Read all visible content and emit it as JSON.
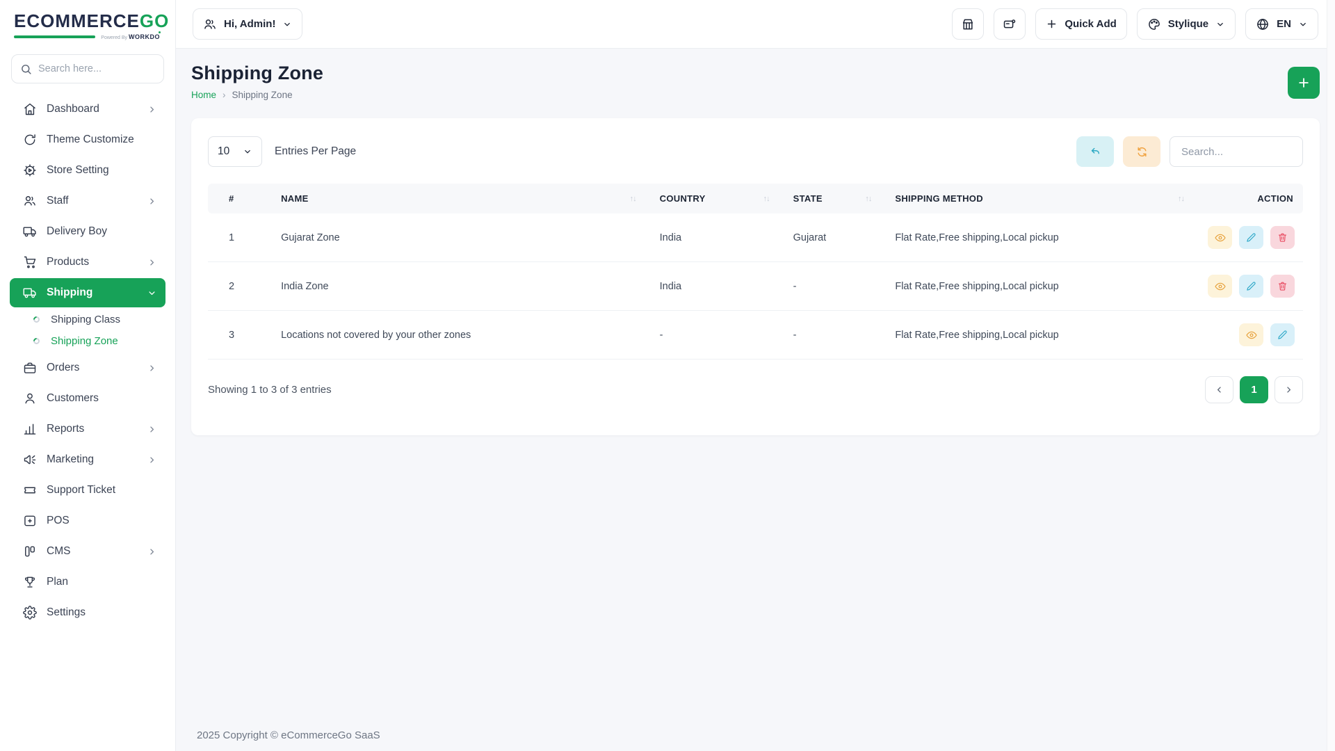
{
  "brand": {
    "name": "ECOMMERCE",
    "accent": "GO",
    "powered_by": "Powered By",
    "powered_brand": "WORKDO"
  },
  "colors": {
    "accent_green": "#17a258",
    "view_orange": "#e7a13b",
    "edit_teal": "#2aa7c7",
    "delete_red": "#e8495f",
    "cyan_chip": "#d8f1f5",
    "orange_chip": "#fcebd4"
  },
  "topbar": {
    "user_button": "Hi, Admin!",
    "quick_add_label": "Quick Add",
    "style_label": "Stylique",
    "language_label": "EN"
  },
  "sidebar": {
    "search_placeholder": "Search here...",
    "items": [
      {
        "label": "Dashboard"
      },
      {
        "label": "Theme Customize"
      },
      {
        "label": "Store Setting"
      },
      {
        "label": "Staff"
      },
      {
        "label": "Delivery Boy"
      },
      {
        "label": "Products"
      },
      {
        "label": "Shipping"
      },
      {
        "label": "Shipping Class"
      },
      {
        "label": "Shipping Zone"
      },
      {
        "label": "Orders"
      },
      {
        "label": "Customers"
      },
      {
        "label": "Reports"
      },
      {
        "label": "Marketing"
      },
      {
        "label": "Support Ticket"
      },
      {
        "label": "POS"
      },
      {
        "label": "CMS"
      },
      {
        "label": "Plan"
      },
      {
        "label": "Settings"
      }
    ]
  },
  "page": {
    "title": "Shipping Zone",
    "breadcrumb_home": "Home",
    "breadcrumb_sep": "›",
    "breadcrumb_current": "Shipping Zone"
  },
  "card": {
    "entries_value": "10",
    "entries_label": "Entries Per Page",
    "search_placeholder": "Search..."
  },
  "table": {
    "headers": {
      "num": "#",
      "name": "NAME",
      "country": "COUNTRY",
      "state": "STATE",
      "method": "SHIPPING METHOD",
      "action": "ACTION"
    },
    "sort_glyph": "↑↓",
    "rows": [
      {
        "num": "1",
        "name": "Gujarat Zone",
        "country": "India",
        "state": "Gujarat",
        "method": "Flat Rate,Free shipping,Local pickup"
      },
      {
        "num": "2",
        "name": "India Zone",
        "country": "India",
        "state": "-",
        "method": "Flat Rate,Free shipping,Local pickup"
      },
      {
        "num": "3",
        "name": "Locations not covered by your other zones",
        "country": "-",
        "state": "-",
        "method": "Flat Rate,Free shipping,Local pickup"
      }
    ],
    "summary": "Showing 1 to 3 of 3 entries"
  },
  "pagination": {
    "current": "1"
  },
  "footer": {
    "copyright": "2025 Copyright © eCommerceGo SaaS"
  }
}
